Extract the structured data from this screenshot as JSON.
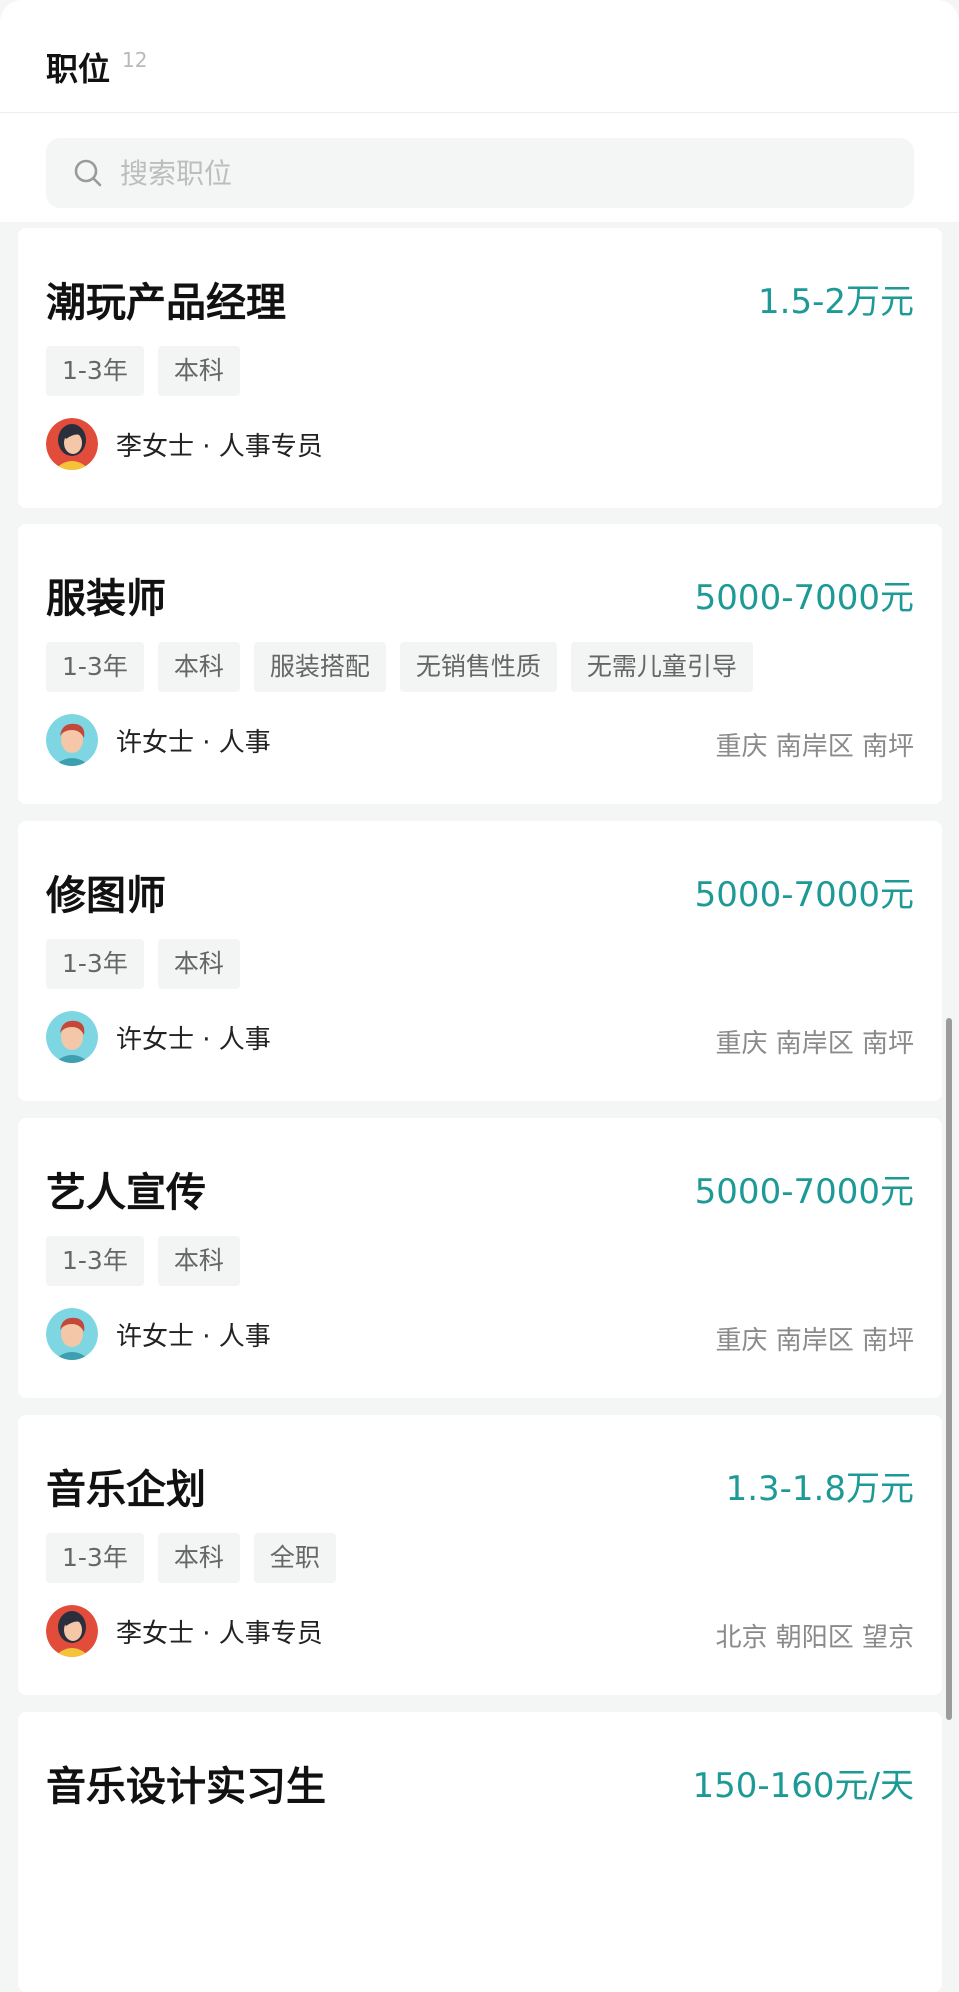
{
  "header": {
    "title": "职位",
    "count": "12"
  },
  "search": {
    "placeholder": "搜索职位"
  },
  "jobs": [
    {
      "title": "潮玩产品经理",
      "salary": "1.5-2万元",
      "tags": [
        "1-3年",
        "本科"
      ],
      "recruiter": "李女士 · 人事专员",
      "location": "",
      "avatar": "female"
    },
    {
      "title": "服装师",
      "salary": "5000-7000元",
      "tags": [
        "1-3年",
        "本科",
        "服装搭配",
        "无销售性质",
        "无需儿童引导"
      ],
      "recruiter": "许女士 · 人事",
      "location": "重庆 南岸区 南坪",
      "avatar": "male"
    },
    {
      "title": "修图师",
      "salary": "5000-7000元",
      "tags": [
        "1-3年",
        "本科"
      ],
      "recruiter": "许女士 · 人事",
      "location": "重庆 南岸区 南坪",
      "avatar": "male"
    },
    {
      "title": "艺人宣传",
      "salary": "5000-7000元",
      "tags": [
        "1-3年",
        "本科"
      ],
      "recruiter": "许女士 · 人事",
      "location": "重庆 南岸区 南坪",
      "avatar": "male"
    },
    {
      "title": "音乐企划",
      "salary": "1.3-1.8万元",
      "tags": [
        "1-3年",
        "本科",
        "全职"
      ],
      "recruiter": "李女士 · 人事专员",
      "location": "北京 朝阳区 望京",
      "avatar": "female"
    },
    {
      "title": "音乐设计实习生",
      "salary": "150-160元/天",
      "tags": [],
      "recruiter": "",
      "location": "",
      "avatar": ""
    }
  ],
  "colors": {
    "accent": "#1d9a96",
    "background": "#f4f5f5"
  },
  "icons": {
    "search": "search-icon"
  }
}
